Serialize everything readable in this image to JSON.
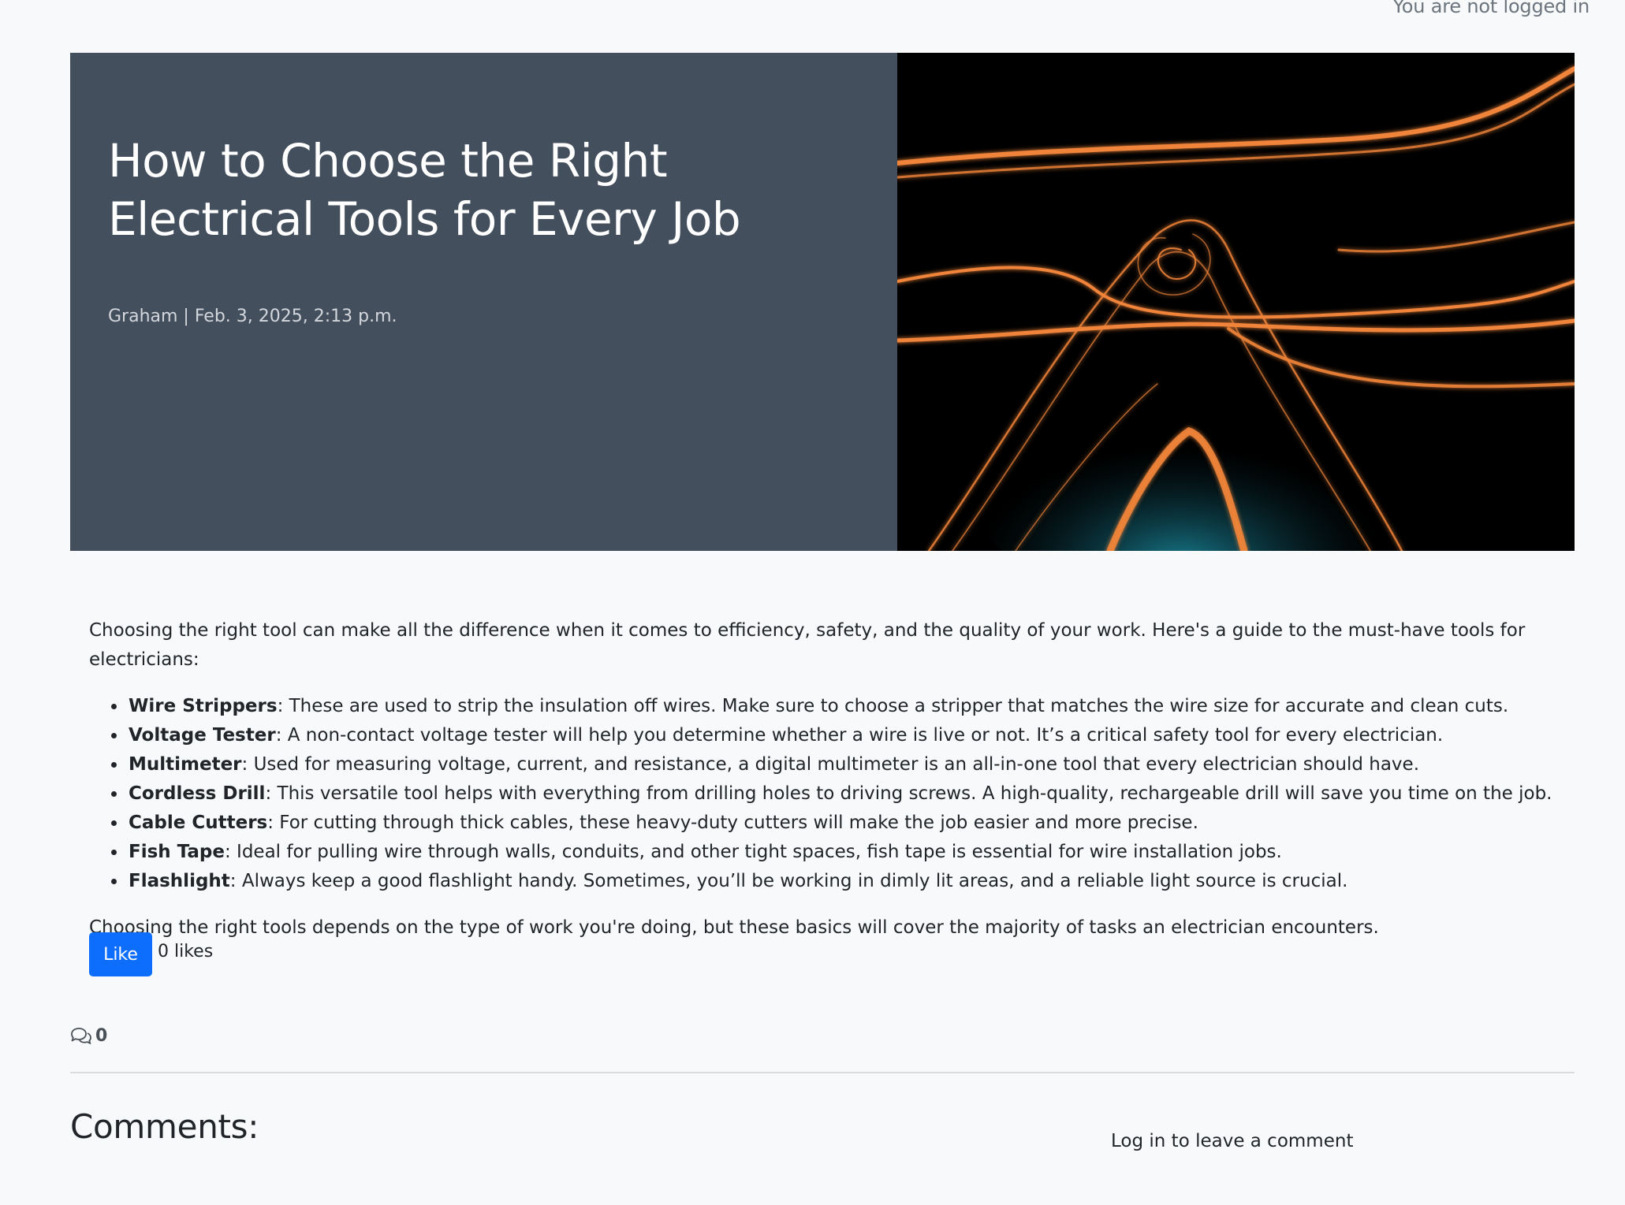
{
  "header": {
    "login_status": "You are not logged in"
  },
  "post": {
    "title": "How to Choose the Right Electrical Tools for Every Job",
    "meta": "Graham | Feb. 3, 2025, 2:13 p.m.",
    "image_icon": "light-trails-photo",
    "intro": "Choosing the right tool can make all the difference when it comes to efficiency, safety, and the quality of your work. Here's a guide to the must-have tools for electricians:",
    "tools": [
      {
        "name": "Wire Strippers",
        "desc": ": These are used to strip the insulation off wires. Make sure to choose a stripper that matches the wire size for accurate and clean cuts."
      },
      {
        "name": "Voltage Tester",
        "desc": ": A non-contact voltage tester will help you determine whether a wire is live or not. It’s a critical safety tool for every electrician."
      },
      {
        "name": "Multimeter",
        "desc": ": Used for measuring voltage, current, and resistance, a digital multimeter is an all-in-one tool that every electrician should have."
      },
      {
        "name": "Cordless Drill",
        "desc": ": This versatile tool helps with everything from drilling holes to driving screws. A high-quality, rechargeable drill will save you time on the job."
      },
      {
        "name": "Cable Cutters",
        "desc": ": For cutting through thick cables, these heavy-duty cutters will make the job easier and more precise."
      },
      {
        "name": "Fish Tape",
        "desc": ": Ideal for pulling wire through walls, conduits, and other tight spaces, fish tape is essential for wire installation jobs."
      },
      {
        "name": "Flashlight",
        "desc": ": Always keep a good flashlight handy. Sometimes, you’ll be working in dimly lit areas, and a reliable light source is crucial."
      }
    ],
    "conclusion": "Choosing the right tools depends on the type of work you're doing, but these basics will cover the majority of tasks an electrician encounters."
  },
  "likes": {
    "button_label": "Like",
    "count_text": "0 likes"
  },
  "comments": {
    "icon": "chat-bubbles-icon",
    "count": "0",
    "heading": "Comments:",
    "login_prompt": "Log in to leave a comment"
  },
  "colors": {
    "hero_panel": "#444f5e",
    "primary": "#0d6efd",
    "background": "#f8f9fa",
    "light_trail": "#f0843a"
  }
}
